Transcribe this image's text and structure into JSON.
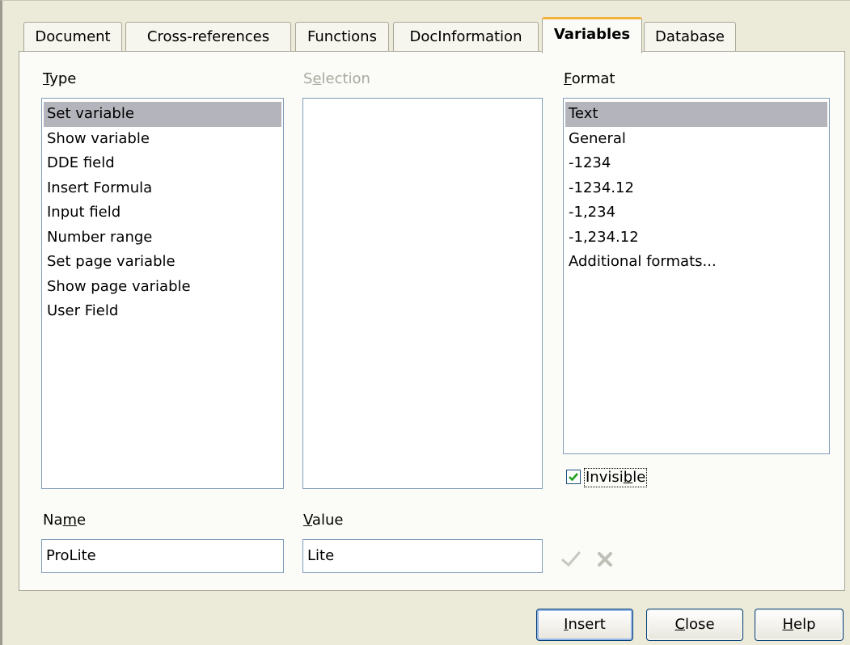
{
  "tabs": [
    {
      "label": "Document",
      "active": false
    },
    {
      "label": "Cross-references",
      "active": false
    },
    {
      "label": "Functions",
      "active": false
    },
    {
      "label": "DocInformation",
      "active": false
    },
    {
      "label": "Variables",
      "active": true
    },
    {
      "label": "Database",
      "active": false
    }
  ],
  "type": {
    "label_first": "T",
    "label_rest": "ype",
    "items": [
      "Set variable",
      "Show variable",
      "DDE field",
      "Insert Formula",
      "Input field",
      "Number range",
      "Set page variable",
      "Show page variable",
      "User Field"
    ],
    "selected": "Set variable"
  },
  "selection": {
    "label_first": "S",
    "label_u": "e",
    "label_rest": "lection",
    "items": []
  },
  "format": {
    "label_first": "F",
    "label_rest": "ormat",
    "items": [
      "Text",
      "General",
      "-1234",
      "-1234.12",
      "-1,234",
      "-1,234.12",
      "Additional formats..."
    ],
    "selected": "Text"
  },
  "invisible": {
    "label_a": "Invisi",
    "label_u": "b",
    "label_b": "le",
    "checked": true
  },
  "name": {
    "label_a": "Na",
    "label_u": "m",
    "label_b": "e",
    "value": "ProLite"
  },
  "value": {
    "label_u": "V",
    "label_rest": "alue",
    "value": "Lite"
  },
  "buttons": {
    "insert_u": "I",
    "insert_rest": "nsert",
    "close_u": "C",
    "close_rest": "lose",
    "help_u": "H",
    "help_rest": "elp"
  },
  "icons": {
    "apply": "checkmark-icon",
    "delete": "delete-x-icon"
  },
  "colors": {
    "active_tab_accent": "#f3b33a",
    "selection_highlight": "#b4b4bc",
    "checkbox_check": "#21a121"
  }
}
